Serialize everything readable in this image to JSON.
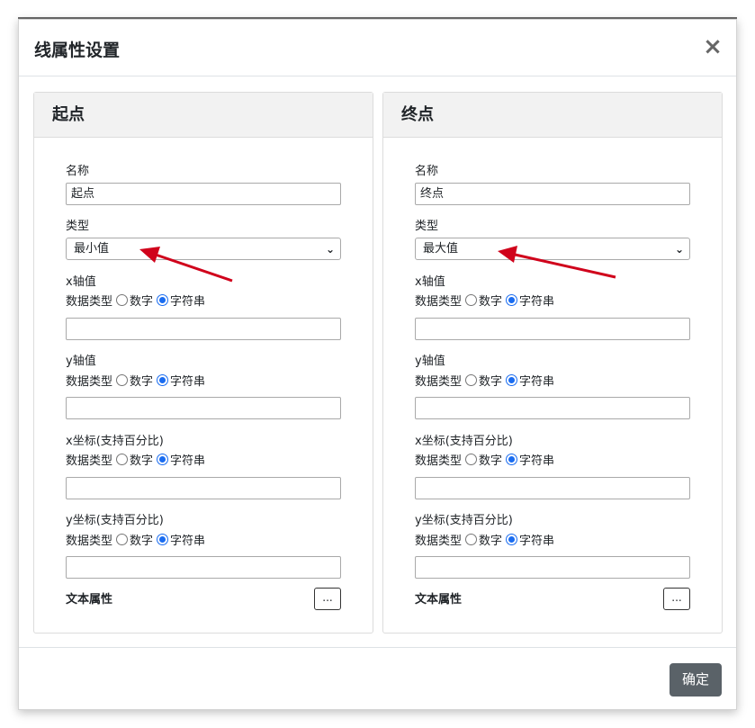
{
  "dialog": {
    "title": "线属性设置",
    "close_label": "×",
    "confirm_label": "确定"
  },
  "start_panel": {
    "header": "起点",
    "name_label": "名称",
    "name_value": "起点",
    "type_label": "类型",
    "type_value": "最小值",
    "x_axis_label": "x轴值",
    "y_axis_label": "y轴值",
    "x_coord_label": "x坐标(支持百分比)",
    "y_coord_label": "y坐标(支持百分比)",
    "data_type_label": "数据类型",
    "option_number": "数字",
    "option_string": "字符串",
    "text_attr_label": "文本属性",
    "text_attr_button": "..."
  },
  "end_panel": {
    "header": "终点",
    "name_label": "名称",
    "name_value": "终点",
    "type_label": "类型",
    "type_value": "最大值",
    "x_axis_label": "x轴值",
    "y_axis_label": "y轴值",
    "x_coord_label": "x坐标(支持百分比)",
    "y_coord_label": "y坐标(支持百分比)",
    "data_type_label": "数据类型",
    "option_number": "数字",
    "option_string": "字符串",
    "text_attr_label": "文本属性",
    "text_attr_button": "..."
  },
  "colors": {
    "annotation_arrow": "#d0021b",
    "radio_checked": "#1a6cf0",
    "confirm_button": "#5a6268"
  }
}
